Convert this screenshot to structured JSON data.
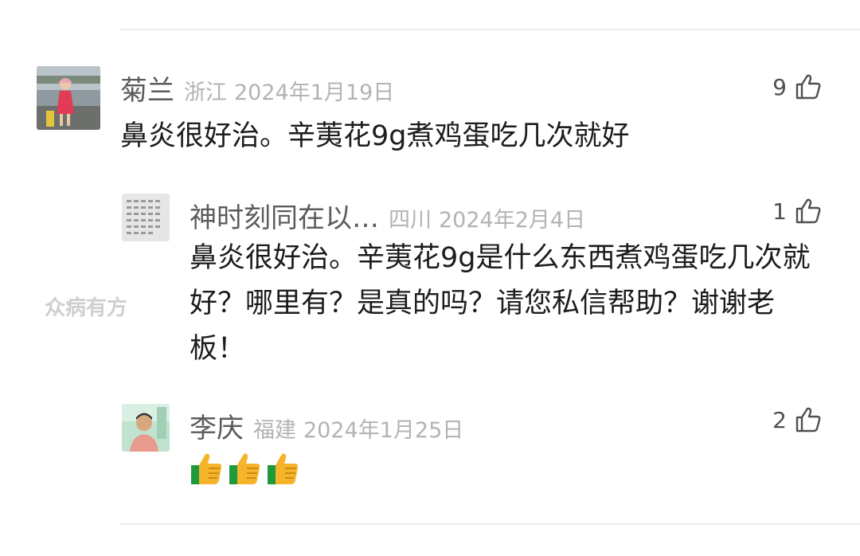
{
  "comments": [
    {
      "name": "菊兰",
      "location": "浙江",
      "date": "2024年1月19日",
      "likes": "9",
      "text": "鼻炎很好治。辛荑花9g煮鸡蛋吃几次就好",
      "avatar_icon": "girl-photo-avatar"
    },
    {
      "name": "神时刻同在以…",
      "location": "四川",
      "date": "2024年2月4日",
      "likes": "1",
      "text": "鼻炎很好治。辛荑花9g是什么东西煮鸡蛋吃几次就好？哪里有？是真的吗？请您私信帮助？谢谢老板！",
      "avatar_icon": "text-grid-avatar"
    },
    {
      "name": "李庆",
      "location": "福建",
      "date": "2024年1月25日",
      "likes": "2",
      "emoji_count": 3,
      "emoji_icon": "thumbs-up-emoji",
      "avatar_icon": "man-photo-avatar"
    }
  ],
  "watermark": "众病有方",
  "like_icon": "thumbs-up-outline-icon",
  "colors": {
    "name": "#5b5b5b",
    "meta": "#b3b3b3",
    "text": "#1c1c1c",
    "divider": "#ececec",
    "watermark": "#cfcfcf"
  }
}
